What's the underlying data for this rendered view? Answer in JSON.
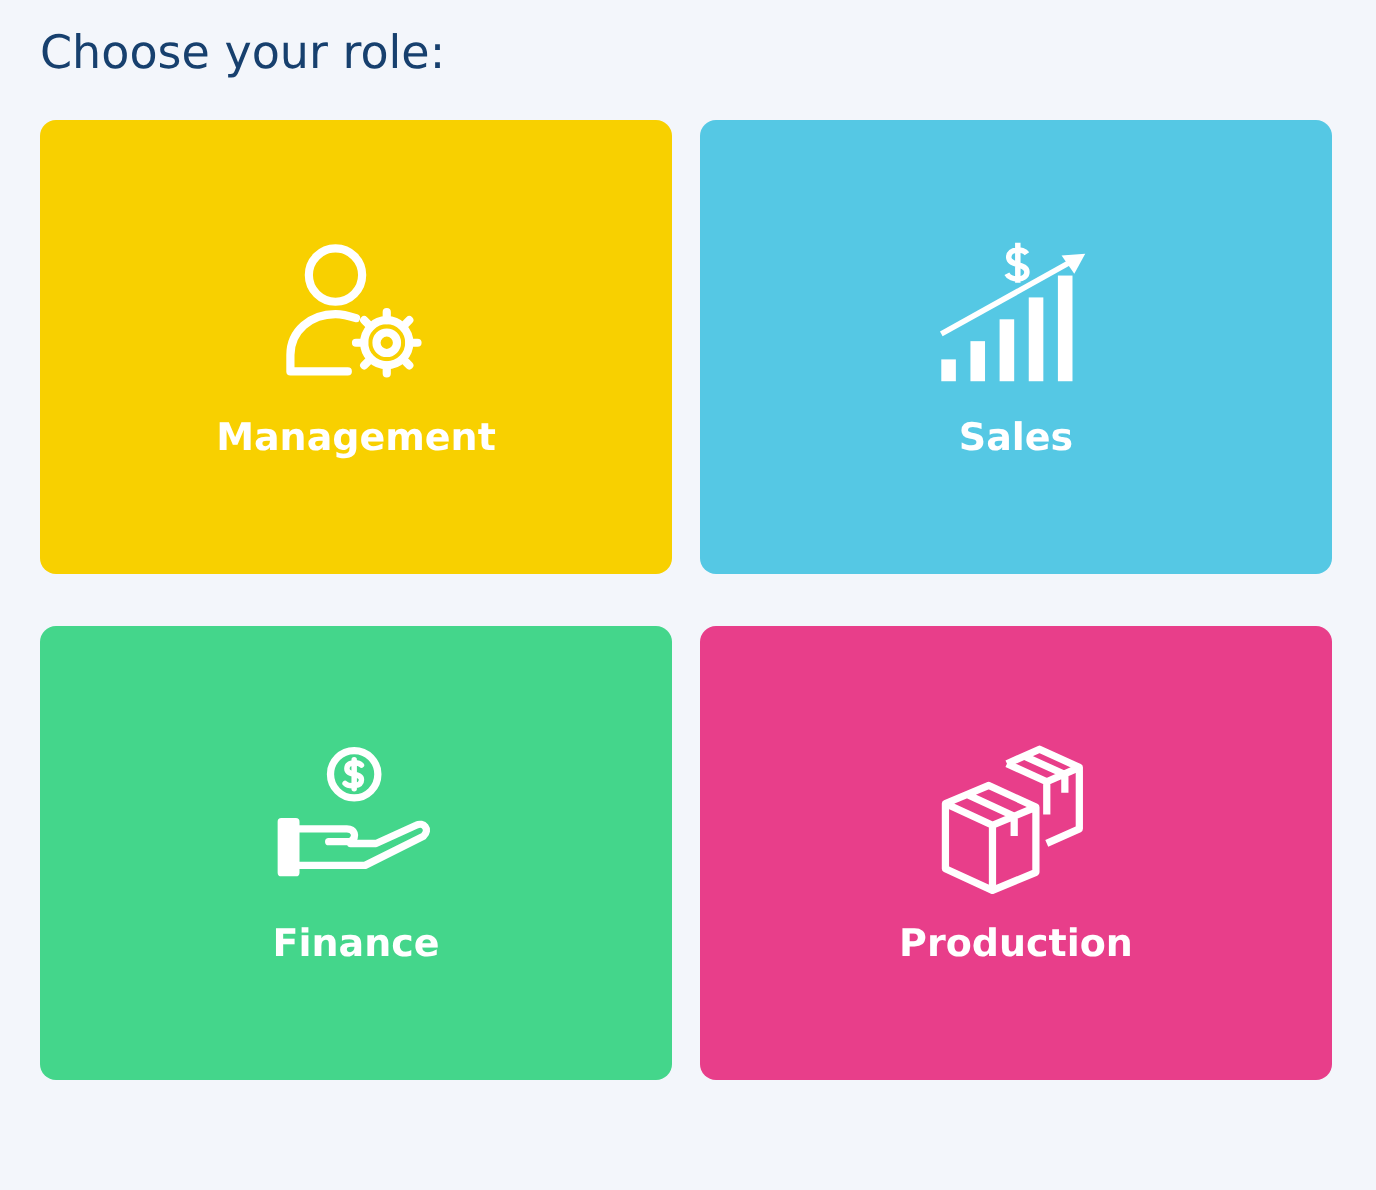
{
  "heading": "Choose your role:",
  "roles": [
    {
      "label": "Management",
      "kind": "person-gear",
      "color": "#f8d000"
    },
    {
      "label": "Sales",
      "kind": "growth-chart",
      "color": "#55c8e4"
    },
    {
      "label": "Finance",
      "kind": "hand-coin",
      "color": "#44d68b"
    },
    {
      "label": "Production",
      "kind": "boxes",
      "color": "#e83e8a"
    }
  ]
}
